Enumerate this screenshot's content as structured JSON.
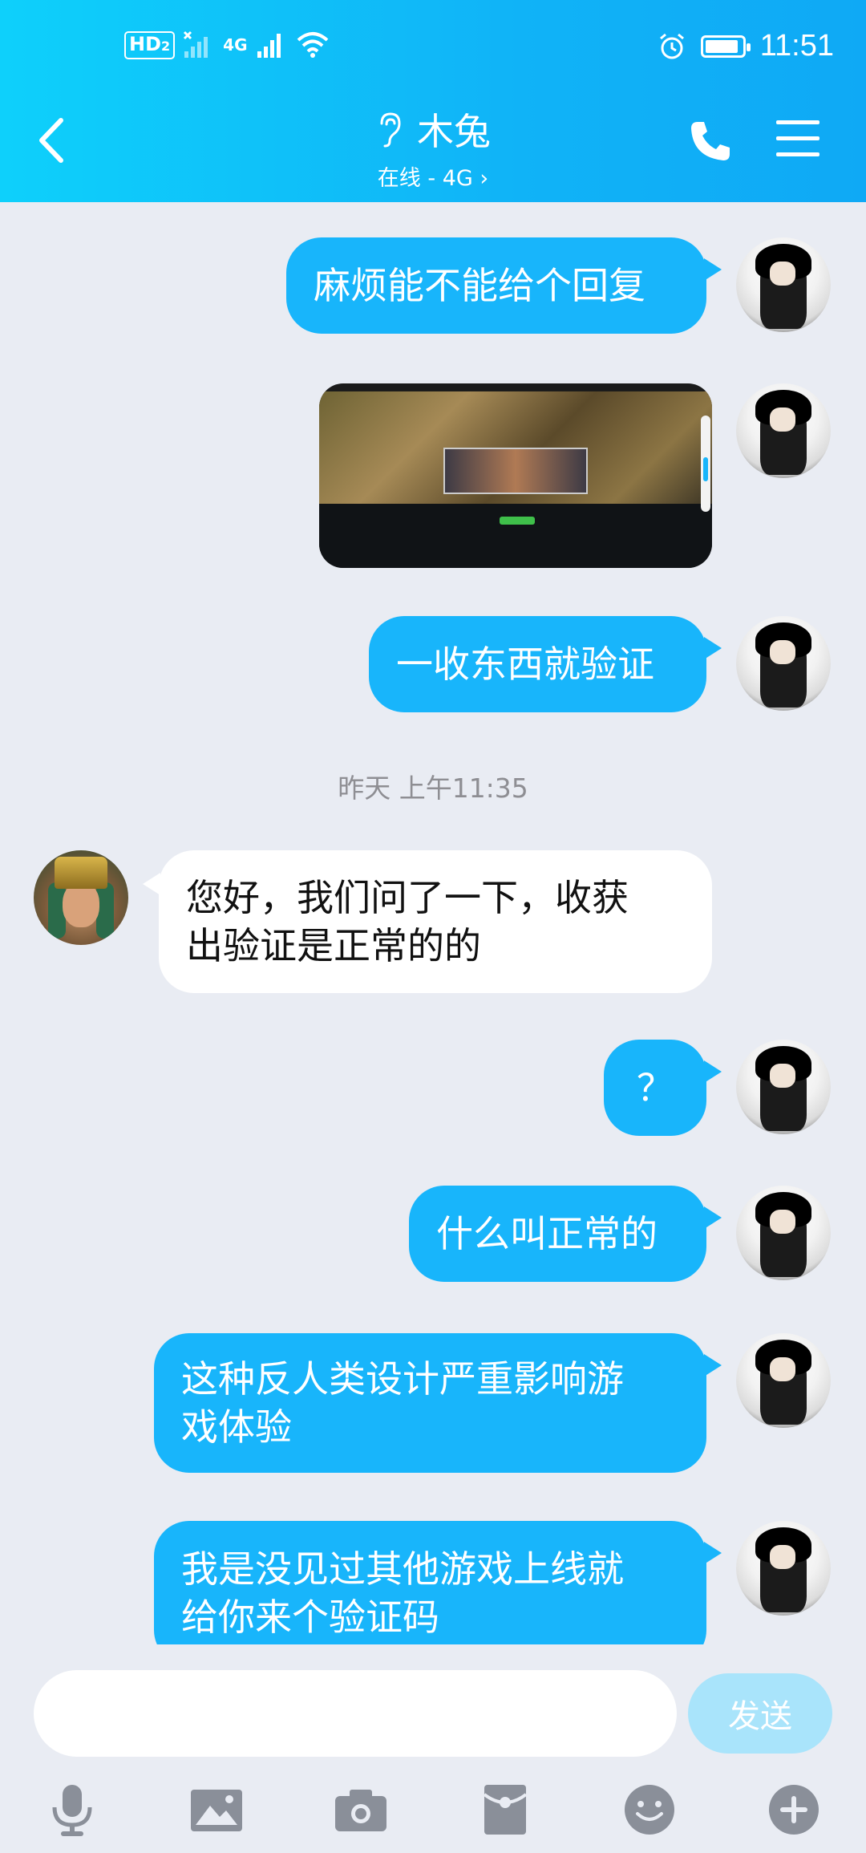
{
  "status_bar": {
    "hd_label": "HD",
    "hd_sub": "2",
    "net_label": "4G",
    "time": "11:51"
  },
  "header": {
    "contact_name": "木兔",
    "status": "在线 - 4G",
    "status_chevron": "›"
  },
  "messages": [
    {
      "from": "me",
      "text": "麻烦能不能给个回复"
    },
    {
      "from": "me",
      "type": "image"
    },
    {
      "from": "me",
      "text": "一收东西就验证"
    },
    {
      "type": "time",
      "text": "昨天 上午11:35"
    },
    {
      "from": "other",
      "line1": "您好，我们问了一下，收获",
      "line2": "出验证是正常的的"
    },
    {
      "from": "me",
      "text": "？"
    },
    {
      "from": "me",
      "text": "什么叫正常的"
    },
    {
      "from": "me",
      "line1": "这种反人类设计严重影响游",
      "line2": "戏体验"
    },
    {
      "from": "me",
      "line1": "我是没见过其他游戏上线就",
      "line2": "给你来个验证码"
    }
  ],
  "input": {
    "placeholder": "",
    "send_label": "发送"
  },
  "toolbar": [
    "mic-icon",
    "image-icon",
    "camera-icon",
    "red-packet-icon",
    "emoji-icon",
    "plus-icon"
  ],
  "colors": {
    "header_start": "#0ed0fb",
    "header_end": "#0fa9f5",
    "bubble_me": "#18b5fb",
    "bubble_other": "#ffffff",
    "background": "#e9ecf3",
    "send_disabled": "#a9e4fb",
    "toolbar_icon": "#8a8f99"
  }
}
